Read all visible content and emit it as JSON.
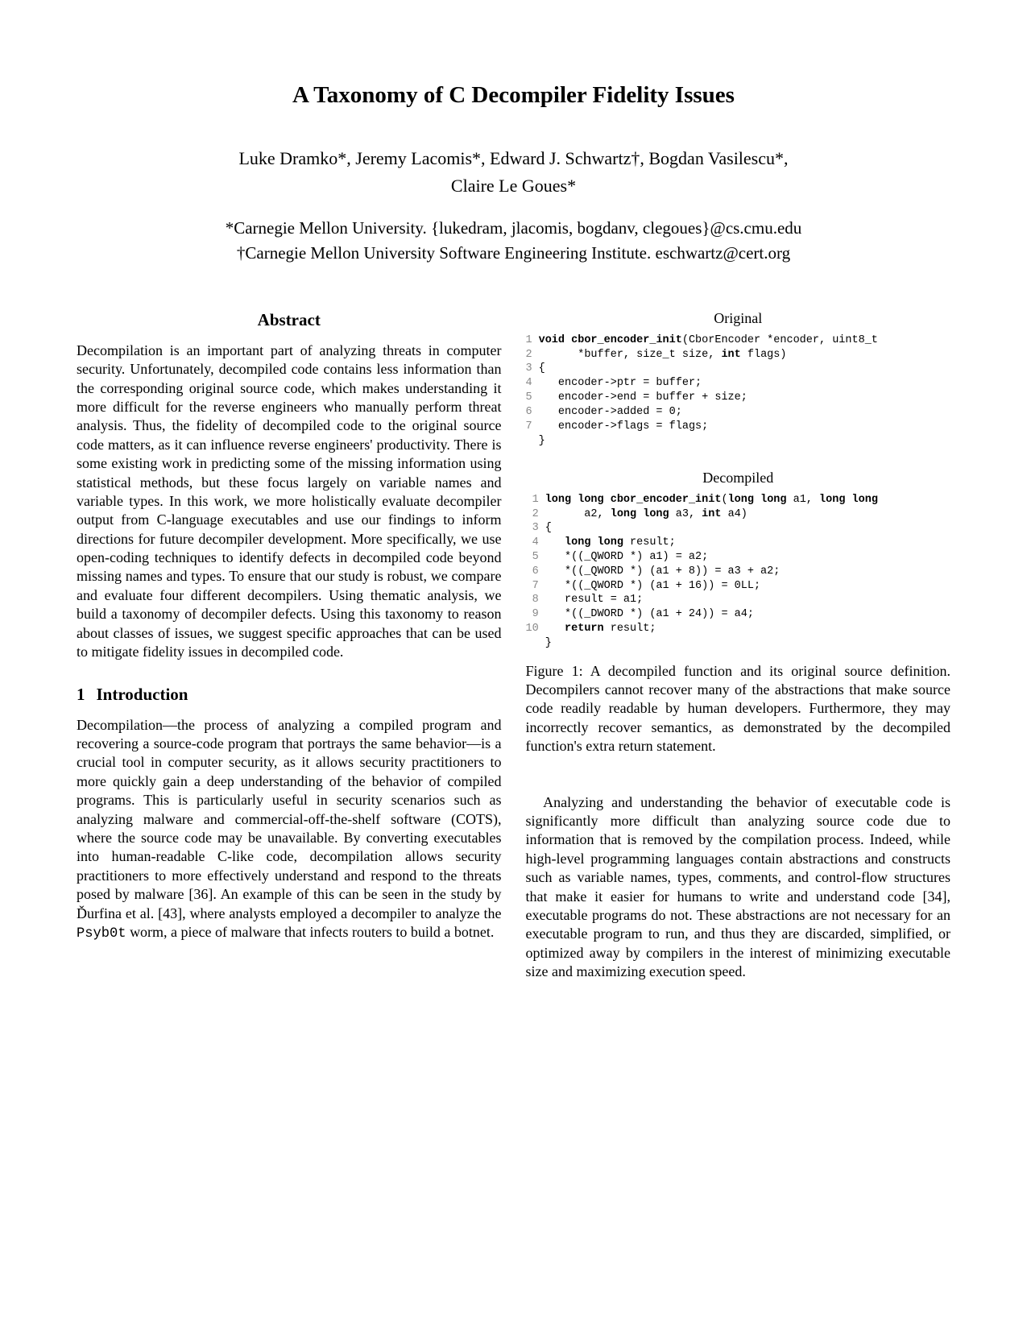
{
  "title": "A Taxonomy of C Decompiler Fidelity Issues",
  "authors_line1": "Luke Dramko*, Jeremy Lacomis*, Edward J. Schwartz†, Bogdan Vasilescu*,",
  "authors_line2": "Claire Le Goues*",
  "affil1": "*Carnegie Mellon University. {lukedram, jlacomis, bogdanv, clegoues}@cs.cmu.edu",
  "affil2": "†Carnegie Mellon University Software Engineering Institute. eschwartz@cert.org",
  "abstract_head": "Abstract",
  "abstract_body": "Decompilation is an important part of analyzing threats in computer security. Unfortunately, decompiled code contains less information than the corresponding original source code, which makes understanding it more difficult for the reverse engineers who manually perform threat analysis. Thus, the fidelity of decompiled code to the original source code matters, as it can influence reverse engineers' productivity. There is some existing work in predicting some of the missing information using statistical methods, but these focus largely on variable names and variable types. In this work, we more holistically evaluate decompiler output from C-language executables and use our findings to inform directions for future decompiler development. More specifically, we use open-coding techniques to identify defects in decompiled code beyond missing names and types. To ensure that our study is robust, we compare and evaluate four different decompilers. Using thematic analysis, we build a taxonomy of decompiler defects. Using this taxonomy to reason about classes of issues, we suggest specific approaches that can be used to mitigate fidelity issues in decompiled code.",
  "intro_num": "1",
  "intro_title": "Introduction",
  "intro_p1a": "Decompilation—the process of analyzing a compiled program and recovering a source-code program that portrays the same behavior—is a crucial tool in computer security, as it allows security practitioners to more quickly gain a deep understanding of the behavior of compiled programs. This is particularly useful in security scenarios such as analyzing malware and commercial-off-the-shelf software (COTS), where the source code may be unavailable. By converting executables into human-readable C-like code, decompilation allows security practitioners to more effectively understand and respond to the threats posed by malware [36]. An example of this can be seen in the study by Ďurfina et al. [43], where analysts employed a decompiler to analyze the ",
  "intro_p1_code": "Psyb0t",
  "intro_p1b": " worm, a piece of malware that infects routers to build a botnet.",
  "listing_original_label": "Original",
  "listing_decompiled_label": "Decompiled",
  "fig1_caption": "Figure 1: A decompiled function and its original source definition. Decompilers cannot recover many of the abstractions that make source code readily readable by human developers. Furthermore, they may incorrectly recover semantics, as demonstrated by the decompiled function's extra return statement.",
  "right_p2": "Analyzing and understanding the behavior of executable code is significantly more difficult than analyzing source code due to information that is removed by the compilation process. Indeed, while high-level programming languages contain abstractions and constructs such as variable names, types, comments, and control-flow structures that make it easier for humans to write and understand code [34], executable programs do not. These abstractions are not necessary for an executable program to run, and thus they are discarded, simplified, or optimized away by compilers in the interest of minimizing executable size and maximizing execution speed.",
  "code_original": {
    "nums": "1\n2\n3\n4\n5\n6\n7",
    "text": "void cbor_encoder_init(CborEncoder *encoder, uint8_t\n      *buffer, size_t size, int flags)\n{\n   encoder->ptr = buffer;\n   encoder->end = buffer + size;\n   encoder->added = 0;\n   encoder->flags = flags;\n}"
  },
  "code_decompiled": {
    "nums": "1\n2\n3\n4\n5\n6\n7\n8\n9\n10",
    "text": "long long cbor_encoder_init(long long a1, long long\n      a2, long long a3, int a4)\n{\n   long long result;\n   *((_QWORD *) a1) = a2;\n   *((_QWORD *) (a1 + 8)) = a3 + a2;\n   *((_QWORD *) (a1 + 16)) = 0LL;\n   result = a1;\n   *((_DWORD *) (a1 + 24)) = a4;\n   return result;\n}"
  }
}
